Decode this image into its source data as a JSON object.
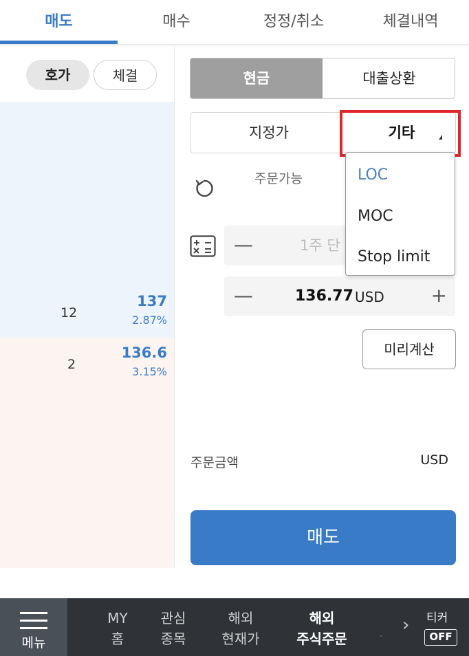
{
  "top_tabs": [
    "매도",
    "매수",
    "정정/취소",
    "체결내역"
  ],
  "left": {
    "pill_hoga": "호가",
    "pill_chegyeol": "체결",
    "rows": [
      {
        "qty": "12",
        "price": "137",
        "pct": "2.87%"
      },
      {
        "qty": "2",
        "price": "136.6",
        "pct": "3.15%"
      }
    ]
  },
  "payment": {
    "cash": "현금",
    "loan": "대출상환"
  },
  "order_type": {
    "limit": "지정가",
    "other": "기타"
  },
  "available_label": "주문가능",
  "quantity": {
    "placeholder": "1주 단"
  },
  "price": {
    "value": "136.77",
    "unit": "USD"
  },
  "precalc_label": "미리계산",
  "order_amount": {
    "label": "주문금액",
    "unit": "USD"
  },
  "sell_button": "매도",
  "dropdown": {
    "options": [
      "LOC",
      "MOC",
      "Stop limit"
    ],
    "selected": "LOC"
  },
  "bottom_nav": {
    "menu": "메뉴",
    "items": [
      {
        "line1": "MY",
        "line2": "홈"
      },
      {
        "line1": "관심",
        "line2": "종목"
      },
      {
        "line1": "해외",
        "line2": "현재가"
      },
      {
        "line1": "해외",
        "line2": "주식주문"
      }
    ],
    "ticker": "티커",
    "ticker_state": "OFF"
  },
  "colors": {
    "accent": "#3a7bc8",
    "highlight": "#e0262b",
    "nav_bg": "#2f3338"
  }
}
